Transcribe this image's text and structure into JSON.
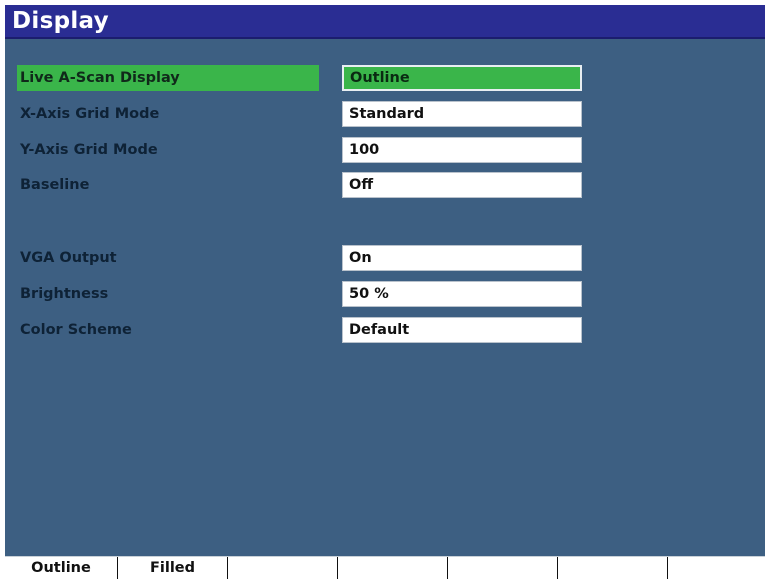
{
  "window": {
    "title": "Display"
  },
  "settings": [
    {
      "label": "Live A-Scan Display",
      "value": "Outline",
      "selected": true
    },
    {
      "label": "X-Axis Grid Mode",
      "value": "Standard",
      "selected": false
    },
    {
      "label": "Y-Axis Grid Mode",
      "value": "100",
      "selected": false
    },
    {
      "label": "Baseline",
      "value": "Off",
      "selected": false
    },
    {
      "label": "VGA Output",
      "value": "On",
      "selected": false
    },
    {
      "label": "Brightness",
      "value": "50 %",
      "selected": false
    },
    {
      "label": "Color Scheme",
      "value": "Default",
      "selected": false
    }
  ],
  "softkeys": [
    {
      "label": "Outline"
    },
    {
      "label": "Filled"
    },
    {
      "label": ""
    },
    {
      "label": ""
    },
    {
      "label": ""
    },
    {
      "label": ""
    },
    {
      "label": ""
    }
  ],
  "colors": {
    "title_bar": "#2a2d93",
    "background": "#3d5f82",
    "selection": "#3ab54a",
    "label_text": "#0e2236"
  }
}
